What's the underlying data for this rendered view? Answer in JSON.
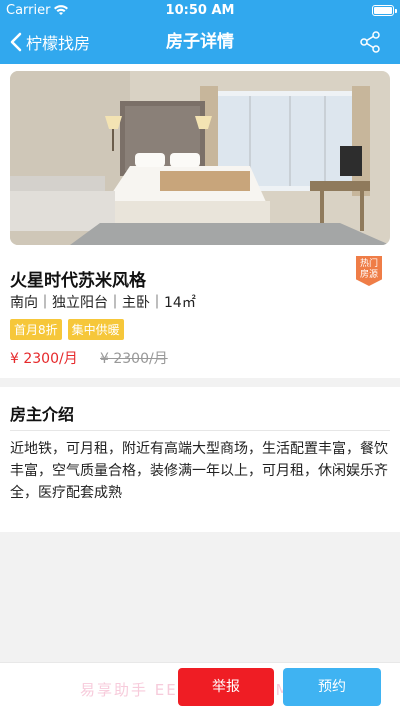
{
  "status_bar": {
    "carrier": "Carrier",
    "time": "10:50 AM"
  },
  "nav": {
    "back_label": "柠檬找房",
    "title": "房子详情"
  },
  "house": {
    "title": "火星时代苏米风格",
    "meta": "南向｜独立阳台｜主卧｜14㎡",
    "hot_badge": "热门房源",
    "tags": [
      "首月8折",
      "集中供暖"
    ],
    "price": "¥ 2300/月",
    "old_price": "¥ 2300/月"
  },
  "owner": {
    "title": "房主介绍",
    "description": "近地铁，可月租，附近有高端大型商场，生活配置丰富，餐饮丰富，空气质量合格，装修满一年以上，可月租，休闲娱乐齐全，医疗配套成熟"
  },
  "bottom": {
    "watermark": "易享助手 EEDD.ZJZ.COM",
    "report_label": "举报",
    "book_label": "预约"
  },
  "colors": {
    "brand": "#31a8ee",
    "price": "#e6292b",
    "tag": "#f6c73a",
    "report": "#ef1d24",
    "book": "#3fb3f2"
  }
}
